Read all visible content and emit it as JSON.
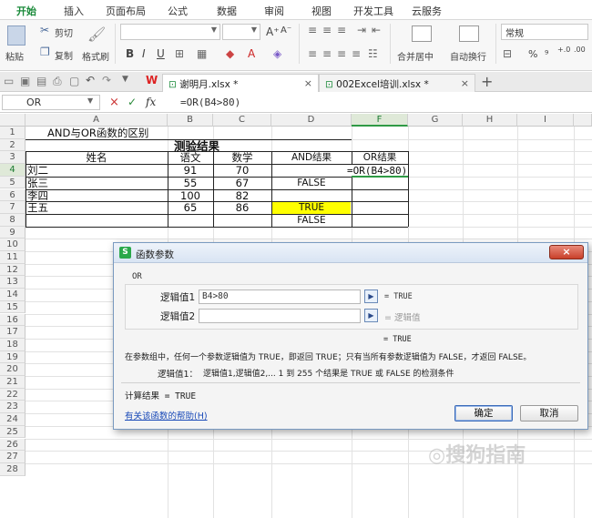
{
  "menu": {
    "tabs": [
      "开始",
      "插入",
      "页面布局",
      "公式",
      "数据",
      "审阅",
      "视图",
      "开发工具",
      "云服务"
    ]
  },
  "toolbar": {
    "paste": "粘贴",
    "cut": "剪切",
    "copy": "复制",
    "format_painter": "格式刷",
    "bold": "B",
    "italic": "I",
    "underline": "U",
    "font_grow": "A⁺",
    "font_shrink": "A⁻",
    "merge_center": "合并居中",
    "wrap_text": "自动换行",
    "number_format": "常规",
    "percent": "%",
    "thousands": "⁹",
    "dec_inc": "+.0",
    "dec_dec": ".00"
  },
  "quick_access": {
    "undo": "↶",
    "redo": "↷"
  },
  "file_tabs": [
    {
      "label": "谢明月.xlsx *",
      "close": "×"
    },
    {
      "label": "002Excel培训.xlsx *",
      "close": "×"
    }
  ],
  "add_tab": "+",
  "formula_bar": {
    "name_box": "OR",
    "cancel": "×",
    "confirm": "✓",
    "fx": "fx",
    "formula": "=OR(B4>80)"
  },
  "columns": [
    "A",
    "B",
    "C",
    "D",
    "E",
    "F",
    "G",
    "H",
    "I"
  ],
  "rows": [
    "1",
    "2",
    "3",
    "4",
    "5",
    "6",
    "7",
    "8",
    "9",
    "10",
    "11",
    "12",
    "13",
    "14",
    "15",
    "16",
    "17",
    "18",
    "19",
    "20",
    "21",
    "22",
    "23",
    "24",
    "25",
    "26",
    "27",
    "28"
  ],
  "sheet": {
    "a1": "AND与OR函数的区别",
    "title": "测验结果",
    "headers": {
      "name": "姓名",
      "chinese": "语文",
      "math": "数学",
      "and_result": "AND结果",
      "or_result": "OR结果"
    },
    "records": [
      {
        "name": "刘二",
        "chinese": "91",
        "math": "70",
        "and_result": "",
        "or_result": "=OR(B4>80)"
      },
      {
        "name": "张三",
        "chinese": "55",
        "math": "67",
        "and_result": "FALSE",
        "or_result": ""
      },
      {
        "name": "李四",
        "chinese": "100",
        "math": "82",
        "and_result": "TRUE",
        "or_result": ""
      },
      {
        "name": "王五",
        "chinese": "65",
        "math": "86",
        "and_result": "FALSE",
        "or_result": ""
      }
    ]
  },
  "dialog": {
    "title": "函数参数",
    "logo": "S",
    "close": "×",
    "function_name": "OR",
    "args": [
      {
        "label": "逻辑值1",
        "value": "B4>80",
        "result": "= TRUE"
      },
      {
        "label": "逻辑值2",
        "value": "",
        "result": "= 逻辑值"
      }
    ],
    "overall_result": "= TRUE",
    "description": "在参数组中，任何一个参数逻辑值为 TRUE，即返回 TRUE；只有当所有参数逻辑值为 FALSE，才返回 FALSE。",
    "arg_help_label": "逻辑值1：",
    "arg_help": "逻辑值1,逻辑值2,... 1 到 255 个结果是 TRUE 或 FALSE 的检测条件",
    "calc_result": "计算结果 = TRUE",
    "help_link": "有关该函数的帮助(H)",
    "ok": "确定",
    "cancel": "取消"
  },
  "colors": {
    "accent_green": "#1a8a3a",
    "highlight_yellow": "#ffff00",
    "link_blue": "#1a4ab8"
  }
}
